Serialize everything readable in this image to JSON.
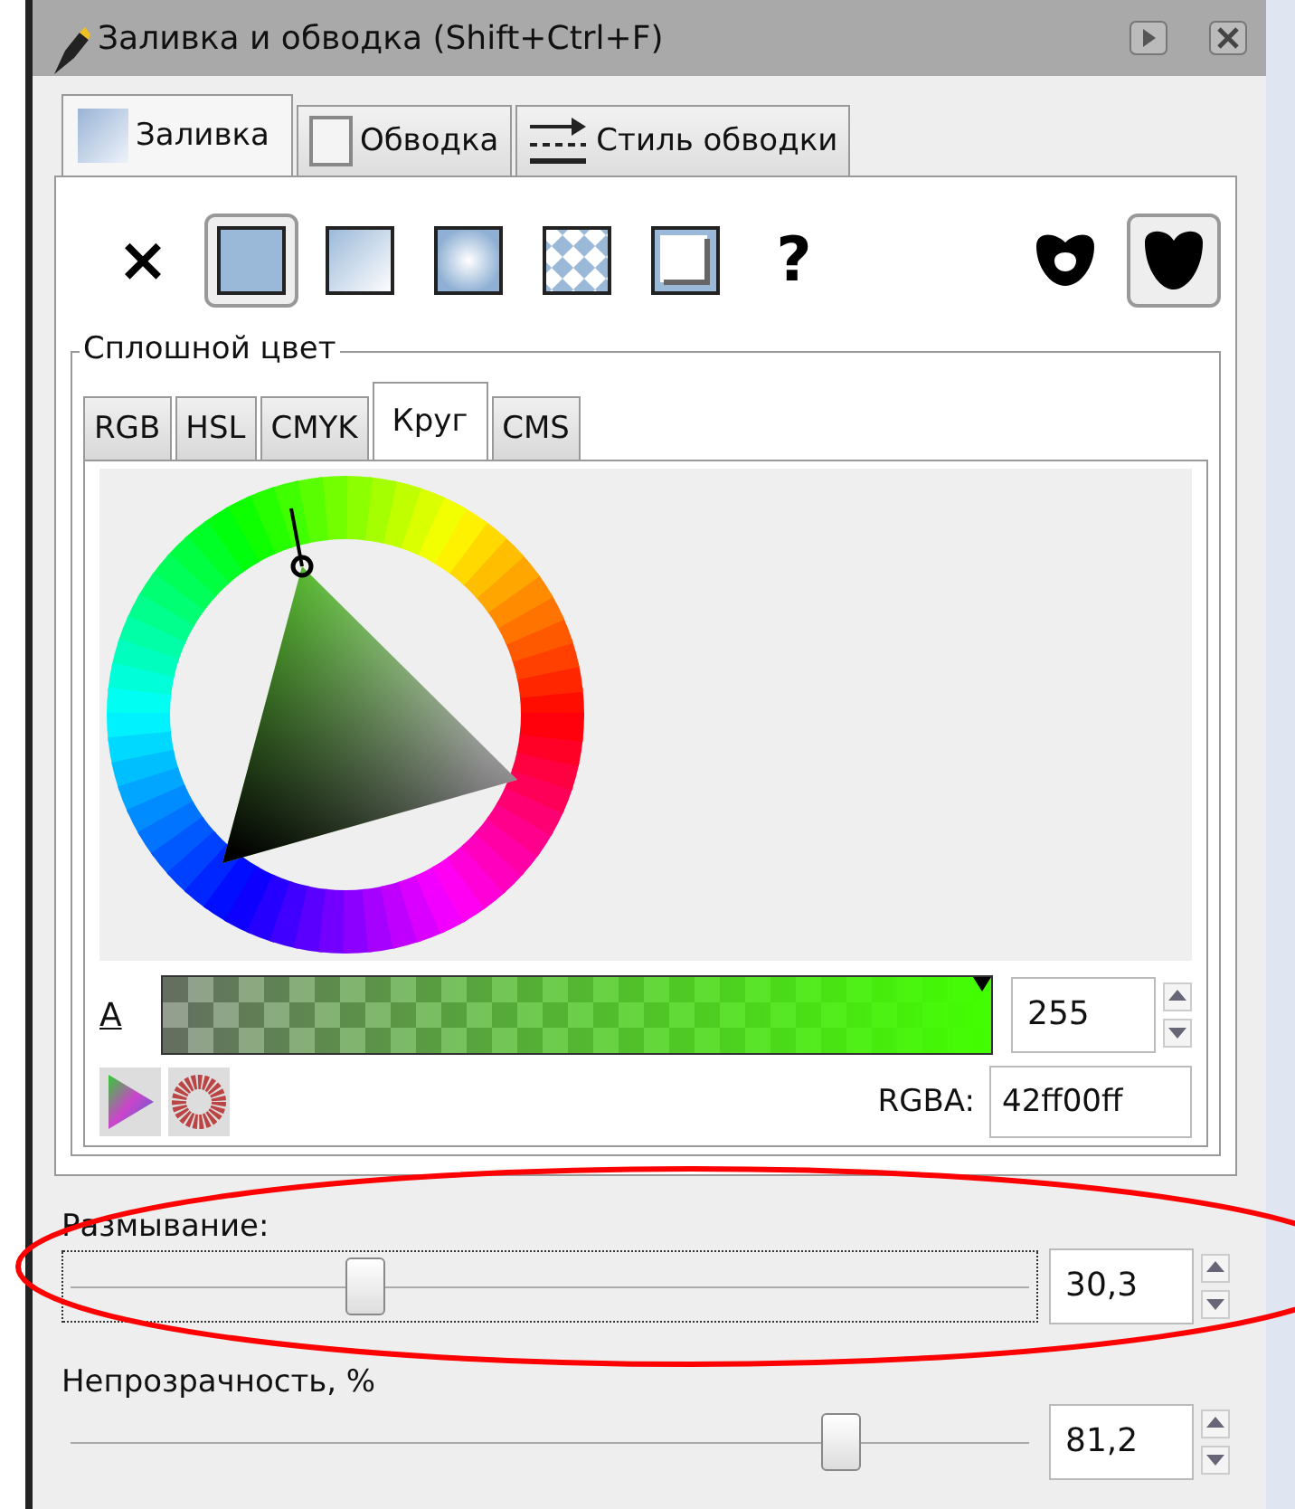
{
  "window": {
    "title": "Заливка и обводка (Shift+Ctrl+F)"
  },
  "tabs": [
    {
      "label": "Заливка",
      "kind": "fill",
      "selected": true
    },
    {
      "label": "Обводка",
      "kind": "stroke",
      "selected": false
    },
    {
      "label": "Стиль обводки",
      "kind": "stroke-style",
      "selected": false
    }
  ],
  "fill_modes": [
    {
      "kind": "none",
      "label": "×",
      "selected": false
    },
    {
      "kind": "flat",
      "selected": true
    },
    {
      "kind": "linear",
      "selected": false
    },
    {
      "kind": "radial",
      "selected": false
    },
    {
      "kind": "pattern",
      "selected": false
    },
    {
      "kind": "swatch",
      "selected": false
    },
    {
      "kind": "unset",
      "label": "?",
      "selected": false
    }
  ],
  "fill_rules": [
    {
      "kind": "evenodd",
      "selected": false
    },
    {
      "kind": "nonzero",
      "selected": true
    }
  ],
  "color": {
    "legend": "Сплошной цвет",
    "tabs": [
      {
        "label": "RGB",
        "selected": false
      },
      {
        "label": "HSL",
        "selected": false
      },
      {
        "label": "CMYK",
        "selected": false
      },
      {
        "label": "Круг",
        "selected": true
      },
      {
        "label": "CMS",
        "selected": false
      }
    ],
    "alpha": {
      "label": "A",
      "value": "255",
      "level": 1
    },
    "rgba": {
      "label": "RGBA:",
      "value": "42ff00ff"
    }
  },
  "blur": {
    "label": "Размывание:",
    "value": "30,3",
    "level": 0.31,
    "focused": true
  },
  "opacity": {
    "label": "Непрозрачность, %",
    "value": "81,2",
    "level": 0.8
  },
  "annotation": {
    "color": "#ff0000"
  }
}
